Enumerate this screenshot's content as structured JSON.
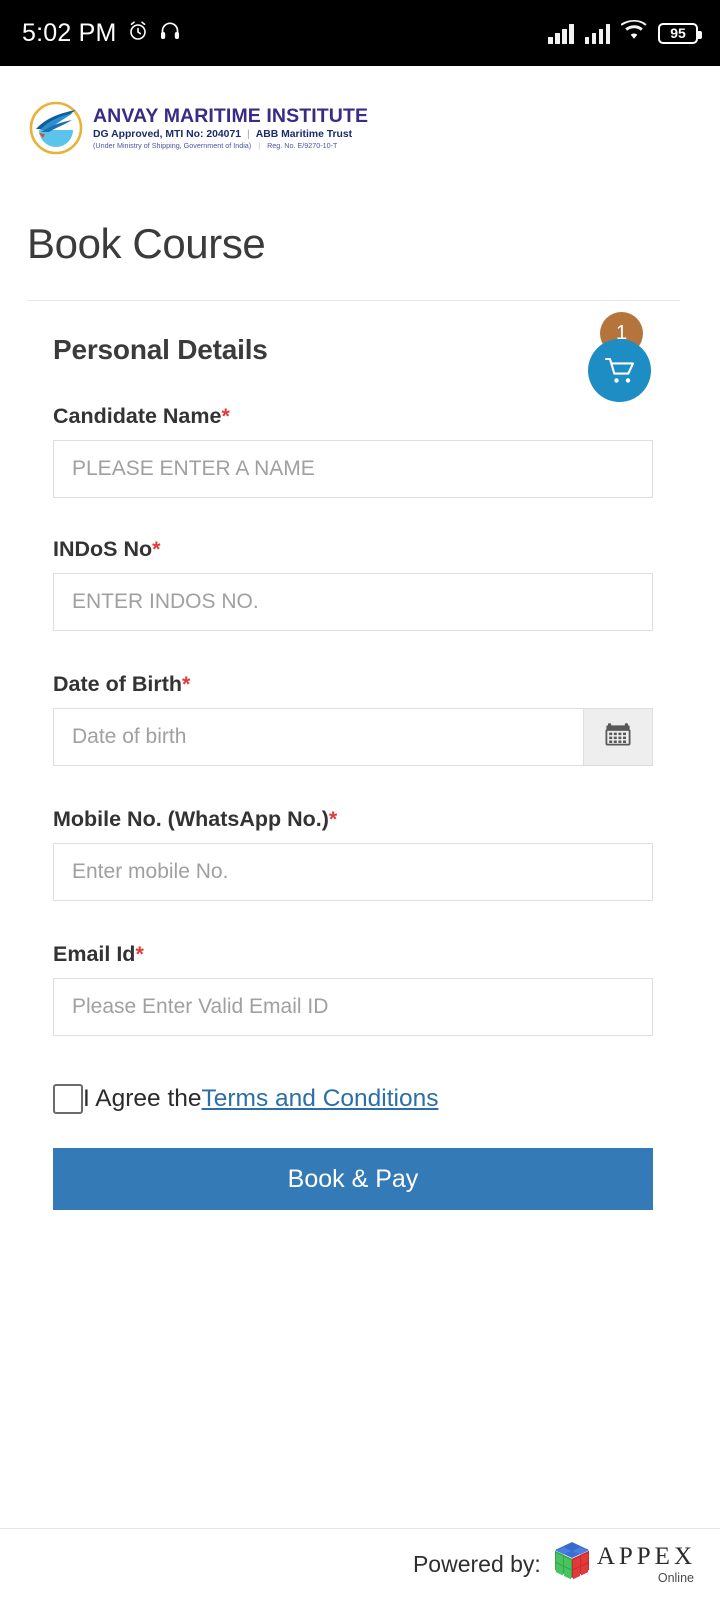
{
  "statusbar": {
    "time": "5:02 PM",
    "alarm_icon": "alarm-clock-icon",
    "headset_icon": "headphones-icon",
    "signal_icon": "signal-bars-icon",
    "signal_icon_2": "signal-bars-icon",
    "wifi_icon": "wifi-icon",
    "battery_level": "95"
  },
  "header": {
    "logo_icon": "anvay-maritime-logo",
    "brand_name": "ANVAY MARITIME INSTITUTE",
    "brand_line2_left": "DG Approved, MTI No: 204071",
    "brand_line2_sep": "|",
    "brand_line2_right": "ABB Maritime Trust",
    "brand_line3_left": "(Under Ministry of Shipping, Government of India)",
    "brand_line3_sep": "|",
    "brand_line3_right": "Reg. No. E/9270-10-T",
    "brand_color": "#3b2a86"
  },
  "page": {
    "title": "Book Course"
  },
  "form": {
    "section_title": "Personal Details",
    "cart": {
      "icon": "shopping-cart-icon",
      "badge_count": "1",
      "badge_color": "#b5743c",
      "circle_color": "#1d8dc4"
    },
    "required_marker": "*",
    "fields": [
      {
        "label": "Candidate Name",
        "required": "*",
        "placeholder": "PLEASE ENTER A NAME",
        "value": ""
      },
      {
        "label": "INDoS No",
        "required": "*",
        "placeholder": "ENTER INDOS NO.",
        "value": ""
      },
      {
        "label": "Date of Birth",
        "required": "*",
        "placeholder": "Date of birth",
        "value": "",
        "button_icon": "calendar-icon"
      },
      {
        "label": "Mobile No. (WhatsApp No.)",
        "required": "*",
        "placeholder": "Enter mobile No.",
        "value": ""
      },
      {
        "label": "Email Id",
        "required": "*",
        "placeholder": "Please Enter Valid Email ID",
        "value": ""
      }
    ],
    "agree": {
      "checked": false,
      "text": "I Agree the ",
      "link_text": "Terms and Conditions",
      "link_color": "#2b6fa8"
    },
    "submit": {
      "label": "Book & Pay",
      "color": "#337ab7"
    }
  },
  "footer": {
    "powered_label": "Powered by:",
    "logo_icon": "appex-cube-icon",
    "brand": "APPEX",
    "brand_sub": "Online"
  }
}
